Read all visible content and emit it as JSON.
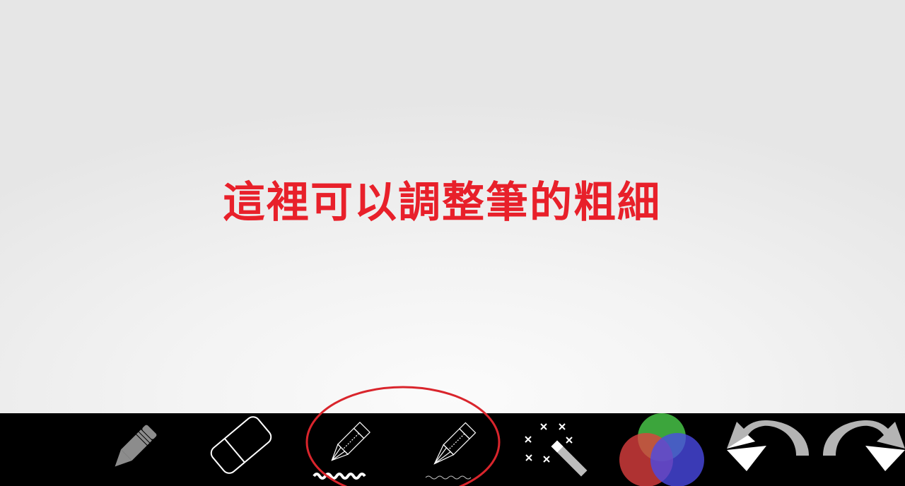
{
  "annotation": {
    "text": "這裡可以調整筆的粗細",
    "color": "#e8202a"
  },
  "colors": {
    "toolbar_bg": "#000000",
    "canvas_bg": "#efefef",
    "highlight": "#d9252c"
  },
  "toolbar": {
    "tools": [
      {
        "id": "pencil",
        "icon": "pencil-icon"
      },
      {
        "id": "eraser",
        "icon": "eraser-icon"
      },
      {
        "id": "thick-pen",
        "icon": "thick-pen-icon"
      },
      {
        "id": "thin-pen",
        "icon": "thin-pen-icon"
      },
      {
        "id": "magic-wand",
        "icon": "magic-wand-icon"
      },
      {
        "id": "color-picker",
        "icon": "color-circles-icon"
      },
      {
        "id": "undo",
        "icon": "undo-arrow-icon"
      },
      {
        "id": "redo",
        "icon": "redo-arrow-icon"
      }
    ]
  }
}
